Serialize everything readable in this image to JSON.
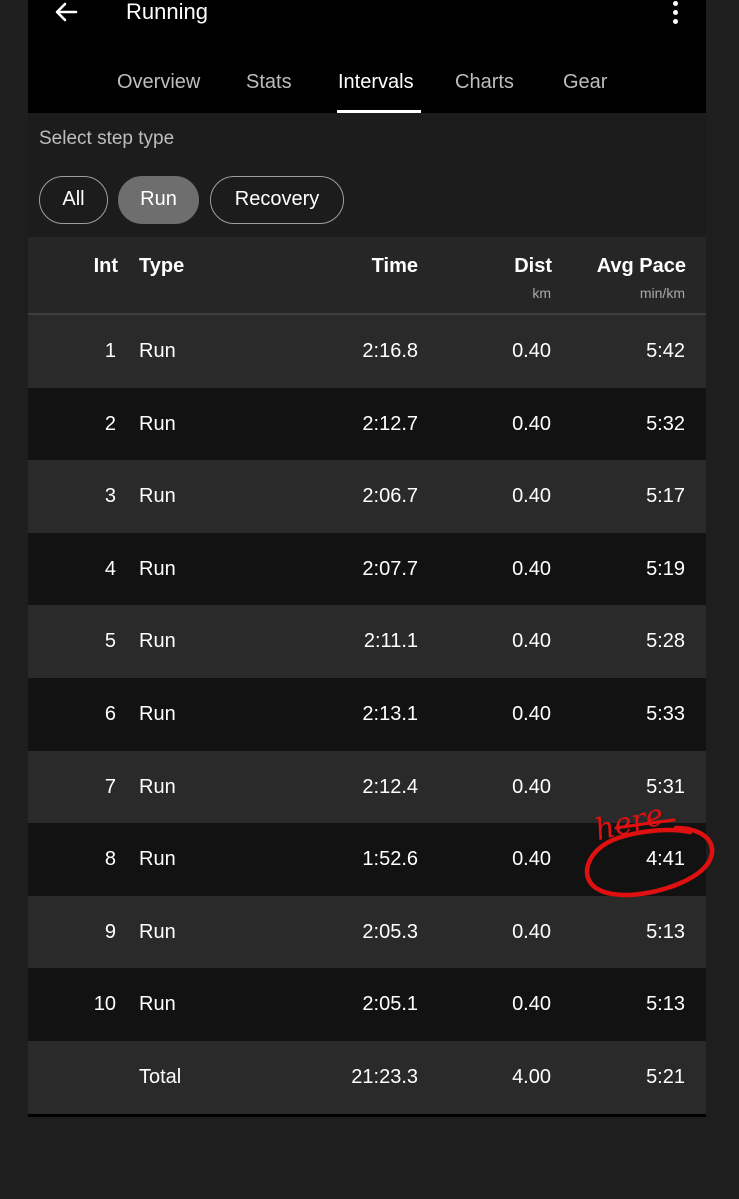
{
  "app": {
    "title": "Running",
    "back_icon": "arrow-left-icon",
    "menu_icon": "more-vert-icon"
  },
  "tabs": [
    {
      "label": "Overview",
      "active": false
    },
    {
      "label": "Stats",
      "active": false
    },
    {
      "label": "Intervals",
      "active": true
    },
    {
      "label": "Charts",
      "active": false
    },
    {
      "label": "Gear",
      "active": false
    }
  ],
  "filter": {
    "label": "Select step type",
    "chips": [
      {
        "label": "All",
        "selected": false
      },
      {
        "label": "Run",
        "selected": true
      },
      {
        "label": "Recovery",
        "selected": false
      }
    ]
  },
  "table": {
    "headers": {
      "int": "Int",
      "type": "Type",
      "time": "Time",
      "dist": "Dist",
      "dist_unit": "km",
      "pace": "Avg Pace",
      "pace_unit": "min/km"
    },
    "rows": [
      {
        "int": "1",
        "type": "Run",
        "time": "2:16.8",
        "dist": "0.40",
        "pace": "5:42"
      },
      {
        "int": "2",
        "type": "Run",
        "time": "2:12.7",
        "dist": "0.40",
        "pace": "5:32"
      },
      {
        "int": "3",
        "type": "Run",
        "time": "2:06.7",
        "dist": "0.40",
        "pace": "5:17"
      },
      {
        "int": "4",
        "type": "Run",
        "time": "2:07.7",
        "dist": "0.40",
        "pace": "5:19"
      },
      {
        "int": "5",
        "type": "Run",
        "time": "2:11.1",
        "dist": "0.40",
        "pace": "5:28"
      },
      {
        "int": "6",
        "type": "Run",
        "time": "2:13.1",
        "dist": "0.40",
        "pace": "5:33"
      },
      {
        "int": "7",
        "type": "Run",
        "time": "2:12.4",
        "dist": "0.40",
        "pace": "5:31"
      },
      {
        "int": "8",
        "type": "Run",
        "time": "1:52.6",
        "dist": "0.40",
        "pace": "4:41"
      },
      {
        "int": "9",
        "type": "Run",
        "time": "2:05.3",
        "dist": "0.40",
        "pace": "5:13"
      },
      {
        "int": "10",
        "type": "Run",
        "time": "2:05.1",
        "dist": "0.40",
        "pace": "5:13"
      }
    ],
    "total": {
      "int": "",
      "type": "Total",
      "time": "21:23.3",
      "dist": "4.00",
      "pace": "5:21"
    }
  },
  "annotation": {
    "text": "here",
    "color": "#e01010"
  },
  "colors": {
    "background": "#000000",
    "row_light": "#2a2a2a",
    "row_dark": "#121212",
    "chip_selected": "#6e6e6e"
  }
}
